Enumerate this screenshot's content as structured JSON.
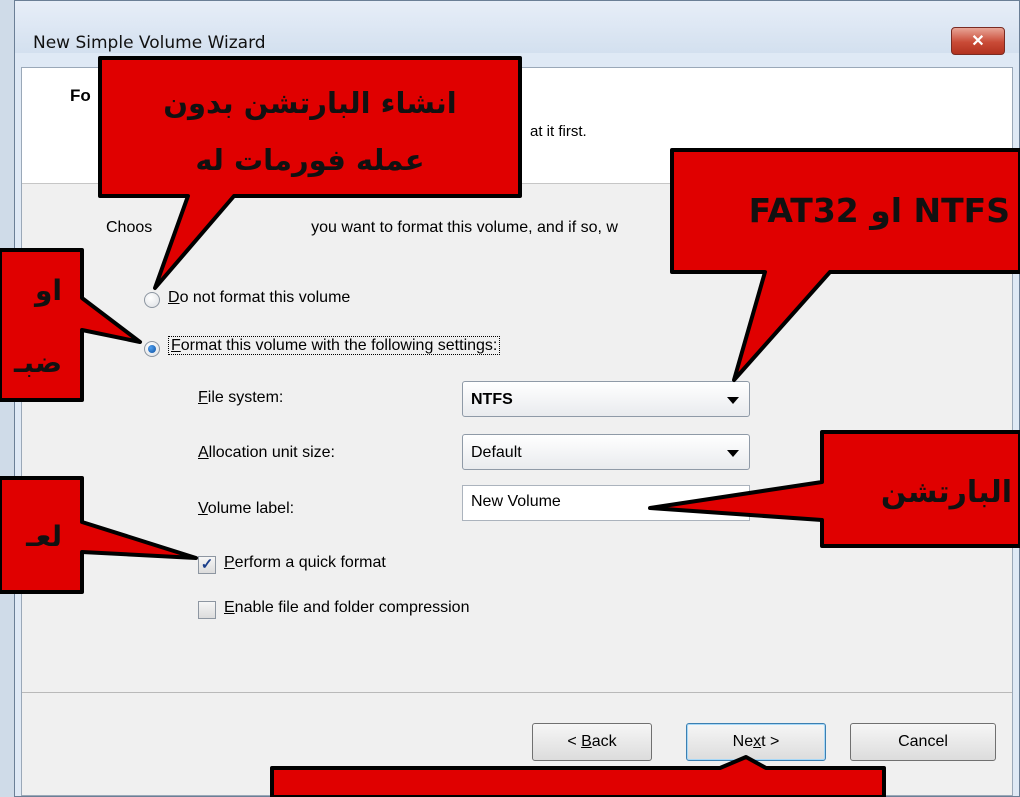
{
  "window": {
    "title": "New Simple Volume Wizard",
    "close_glyph": "✕"
  },
  "header": {
    "title_visible": "Fo",
    "subtitle_visible": "at it first."
  },
  "instruction_parts": [
    "Choos",
    "you want to format this volume, and if so, w"
  ],
  "options": {
    "no_format": {
      "mnemonic": "D",
      "rest": "o not format this volume",
      "selected": false
    },
    "format": {
      "mnemonic": "F",
      "rest": "ormat this volume with the following settings:",
      "selected": true
    }
  },
  "settings": {
    "file_system": {
      "mnemonic": "F",
      "rest": "ile system:",
      "value": "NTFS"
    },
    "allocation": {
      "mnemonic": "A",
      "rest": "llocation unit size:",
      "value": "Default"
    },
    "volume_label": {
      "mnemonic": "V",
      "rest": "olume label:",
      "value": "New Volume"
    }
  },
  "checkboxes": {
    "quick_format": {
      "mnemonic": "P",
      "rest": "erform a quick format",
      "checked": true,
      "check_glyph": "✓"
    },
    "compression": {
      "mnemonic": "E",
      "rest": "nable file and folder compression",
      "checked": false
    }
  },
  "buttons": {
    "back": {
      "prefix": "< ",
      "mnemonic": "B",
      "rest": "ack"
    },
    "next": {
      "prefix": "Ne",
      "mnemonic": "x",
      "rest": "t >"
    },
    "cancel": {
      "label": "Cancel"
    }
  },
  "callouts": {
    "top": {
      "line1": "انشاء البارتشن بدون",
      "line2": "عمله فورمات له"
    },
    "fs": {
      "text": "FAT32 او NTFS"
    },
    "left_format": {
      "line1": "او",
      "line2": "ضبـ"
    },
    "label": {
      "text": "البارتشن"
    },
    "quick": {
      "text": "لعـ"
    }
  },
  "colors": {
    "callout_fill": "#e00000",
    "callout_text": "#111111",
    "accent": "#0d4fa0"
  }
}
